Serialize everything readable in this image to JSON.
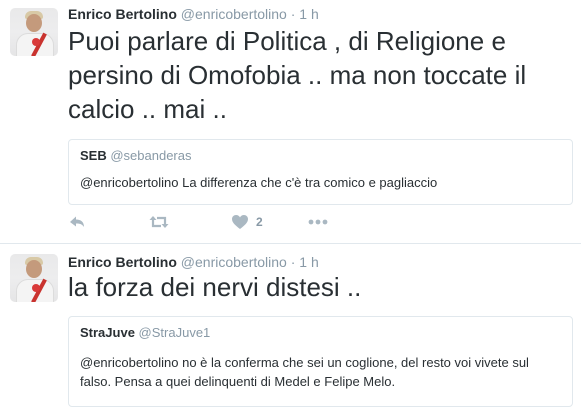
{
  "tweets": [
    {
      "author": "Enrico Bertolino",
      "handle": "@enricobertolino",
      "separator": "·",
      "time": "1 h",
      "text": "Puoi parlare di Politica , di Religione e persino di Omofobia .. ma non toccate il calcio .. mai ..",
      "quote": {
        "author": "SEB",
        "handle": "@sebanderas",
        "text": "@enricobertolino La differenza che c'è tra comico e pagliaccio"
      },
      "actions": {
        "likes": "2"
      }
    },
    {
      "author": "Enrico Bertolino",
      "handle": "@enricobertolino",
      "separator": "·",
      "time": "1 h",
      "text": "la forza dei nervi distesi ..",
      "quote": {
        "author": "StraJuve",
        "handle": "@StraJuve1",
        "text": "@enricobertolino no è la conferma che sei un coglione, del resto voi vivete sul falso. Pensa a quei delinquenti di Medel e Felipe Melo."
      }
    }
  ],
  "icons": [
    "reply-icon",
    "retweet-icon",
    "heart-icon",
    "more-icon"
  ],
  "colors": {
    "text": "#292f33",
    "secondary": "#8899a6",
    "border": "#e1e8ed",
    "icon": "#aab8c2"
  }
}
